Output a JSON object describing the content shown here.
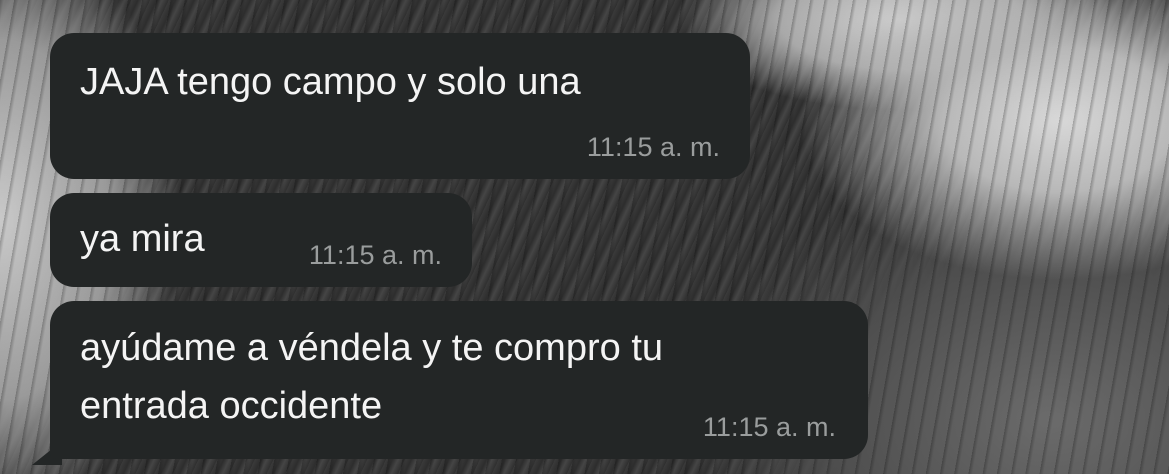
{
  "messages": [
    {
      "text": "JAJA tengo campo y solo una",
      "time": "11:15 a. m."
    },
    {
      "text": "ya mira",
      "time": "11:15 a. m."
    },
    {
      "text": "ayúdame a véndela y te compro tu\nentrada occidente",
      "time": "11:15 a. m."
    }
  ],
  "colors": {
    "bubble_background": "#232626",
    "message_text": "#f4f4f4",
    "timestamp_text": "#9a9d9d"
  }
}
